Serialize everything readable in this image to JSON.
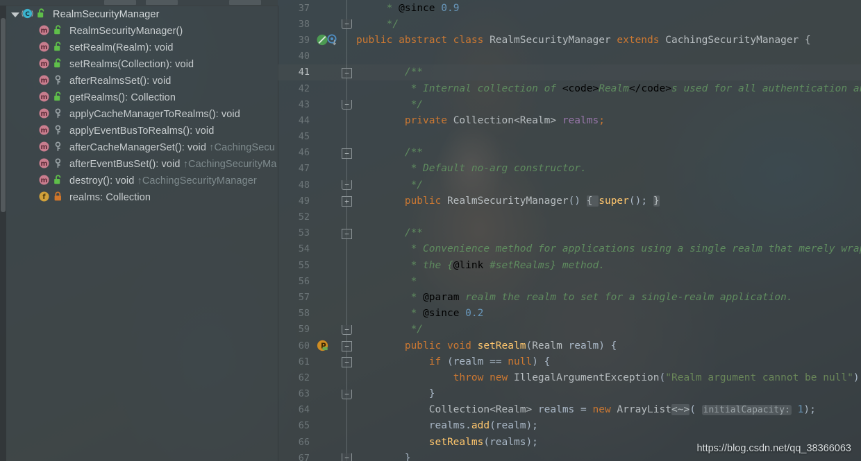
{
  "window": {
    "title": "RealmSecurityManager"
  },
  "toolbar": {
    "chips": [
      "",
      "",
      ""
    ]
  },
  "sidebar": {
    "root": {
      "label": "RealmSecurityManager",
      "icon": "class-icon",
      "visibility": "public-unlock-icon",
      "expanded": true,
      "caret": "chevron-down-icon"
    },
    "items": [
      {
        "label": "RealmSecurityManager()",
        "inherited": "",
        "icon": "method-icon",
        "visibility": "public-unlock-icon"
      },
      {
        "label": "setRealm(Realm): void",
        "inherited": "",
        "icon": "method-icon",
        "visibility": "public-unlock-icon"
      },
      {
        "label": "setRealms(Collection<Realm>): void",
        "inherited": "",
        "icon": "method-icon",
        "visibility": "public-unlock-icon"
      },
      {
        "label": "afterRealmsSet(): void",
        "inherited": "",
        "icon": "method-icon",
        "visibility": "protected-key-icon"
      },
      {
        "label": "getRealms(): Collection<Realm>",
        "inherited": "",
        "icon": "method-icon",
        "visibility": "public-unlock-icon"
      },
      {
        "label": "applyCacheManagerToRealms(): void",
        "inherited": "",
        "icon": "method-icon",
        "visibility": "protected-key-icon"
      },
      {
        "label": "applyEventBusToRealms(): void",
        "inherited": "",
        "icon": "method-icon",
        "visibility": "protected-key-icon"
      },
      {
        "label": "afterCacheManagerSet(): void",
        "inherited": "↑CachingSecu",
        "icon": "method-icon",
        "visibility": "protected-key-icon"
      },
      {
        "label": "afterEventBusSet(): void",
        "inherited": "↑CachingSecurityMa",
        "icon": "method-icon",
        "visibility": "protected-key-icon"
      },
      {
        "label": "destroy(): void",
        "inherited": "↑CachingSecurityManager",
        "icon": "method-icon",
        "visibility": "public-unlock-icon"
      },
      {
        "label": "realms: Collection<Realm>",
        "inherited": "",
        "icon": "field-icon",
        "visibility": "private-lock-icon"
      }
    ]
  },
  "editor": {
    "highlighted_line": 41,
    "lines": [
      {
        "num": "37",
        "mark": "",
        "fold": "",
        "indent": 1,
        "tokens": [
          {
            "t": "cmt",
            "v": " * "
          },
          {
            "t": "tag",
            "v": "@since"
          },
          {
            "t": "cmt",
            "v": " "
          },
          {
            "t": "num",
            "v": "0.9"
          }
        ]
      },
      {
        "num": "38",
        "mark": "",
        "fold": "end",
        "indent": 1,
        "tokens": [
          {
            "t": "cmt",
            "v": " */"
          }
        ]
      },
      {
        "num": "39",
        "mark": "implemented-gutter-icon",
        "fold": "",
        "indent": 0,
        "tokens": [
          {
            "t": "kw",
            "v": "public abstract class "
          },
          {
            "t": "cls",
            "v": "RealmSecurityManager "
          },
          {
            "t": "kw",
            "v": "extends "
          },
          {
            "t": "cls",
            "v": "CachingSecurityManager {"
          }
        ]
      },
      {
        "num": "40",
        "mark": "",
        "fold": "",
        "indent": 0,
        "tokens": []
      },
      {
        "num": "41",
        "mark": "",
        "fold": "start",
        "indent": 2,
        "tokens": [
          {
            "t": "cmt",
            "v": "/**"
          }
        ]
      },
      {
        "num": "42",
        "mark": "",
        "fold": "",
        "indent": 2,
        "tokens": [
          {
            "t": "cmt",
            "v": " * Internal collection of "
          },
          {
            "t": "html",
            "v": "<code>"
          },
          {
            "t": "cmt",
            "v": "Realm"
          },
          {
            "t": "html",
            "v": "</code>"
          },
          {
            "t": "cmt",
            "v": "s used for all authentication and authorizati"
          }
        ]
      },
      {
        "num": "43",
        "mark": "",
        "fold": "end",
        "indent": 2,
        "tokens": [
          {
            "t": "cmt",
            "v": " */"
          }
        ]
      },
      {
        "num": "44",
        "mark": "",
        "fold": "",
        "indent": 2,
        "tokens": [
          {
            "t": "kw",
            "v": "private "
          },
          {
            "t": "cls",
            "v": "Collection<Realm> "
          },
          {
            "t": "fld",
            "v": "realms"
          },
          {
            "t": "kw",
            "v": ";"
          }
        ]
      },
      {
        "num": "45",
        "mark": "",
        "fold": "",
        "indent": 0,
        "tokens": []
      },
      {
        "num": "46",
        "mark": "",
        "fold": "start",
        "indent": 2,
        "tokens": [
          {
            "t": "cmt",
            "v": "/**"
          }
        ]
      },
      {
        "num": "47",
        "mark": "",
        "fold": "",
        "indent": 2,
        "tokens": [
          {
            "t": "cmt",
            "v": " * Default no-arg constructor."
          }
        ]
      },
      {
        "num": "48",
        "mark": "",
        "fold": "end",
        "indent": 2,
        "tokens": [
          {
            "t": "cmt",
            "v": " */"
          }
        ]
      },
      {
        "num": "49",
        "mark": "",
        "fold": "collapsed",
        "indent": 2,
        "tokens": [
          {
            "t": "kw",
            "v": "public "
          },
          {
            "t": "cls",
            "v": "RealmSecurityManager"
          },
          {
            "t": "txt",
            "v": "() "
          },
          {
            "t": "foldph",
            "v": "{ "
          },
          {
            "t": "mth",
            "v": "super"
          },
          {
            "t": "txt",
            "v": "(); "
          },
          {
            "t": "foldph",
            "v": "}"
          }
        ]
      },
      {
        "num": "52",
        "mark": "",
        "fold": "",
        "indent": 0,
        "tokens": []
      },
      {
        "num": "53",
        "mark": "",
        "fold": "start",
        "indent": 2,
        "tokens": [
          {
            "t": "cmt",
            "v": "/**"
          }
        ]
      },
      {
        "num": "54",
        "mark": "",
        "fold": "",
        "indent": 2,
        "tokens": [
          {
            "t": "cmt",
            "v": " * Convenience method for applications using a single realm that merely wraps the realm i"
          }
        ]
      },
      {
        "num": "55",
        "mark": "",
        "fold": "",
        "indent": 2,
        "tokens": [
          {
            "t": "cmt",
            "v": " * the {"
          },
          {
            "t": "tag",
            "v": "@link"
          },
          {
            "t": "cmt",
            "v": " #setRealms} method."
          }
        ]
      },
      {
        "num": "56",
        "mark": "",
        "fold": "",
        "indent": 2,
        "tokens": [
          {
            "t": "cmt",
            "v": " *"
          }
        ]
      },
      {
        "num": "57",
        "mark": "",
        "fold": "",
        "indent": 2,
        "tokens": [
          {
            "t": "cmt",
            "v": " * "
          },
          {
            "t": "tag",
            "v": "@param"
          },
          {
            "t": "cmt",
            "v": " realm the realm to set for a single-realm application."
          }
        ]
      },
      {
        "num": "58",
        "mark": "",
        "fold": "",
        "indent": 2,
        "tokens": [
          {
            "t": "cmt",
            "v": " * "
          },
          {
            "t": "tag",
            "v": "@since"
          },
          {
            "t": "cmt",
            "v": " "
          },
          {
            "t": "num",
            "v": "0.2"
          }
        ]
      },
      {
        "num": "59",
        "mark": "",
        "fold": "end",
        "indent": 2,
        "tokens": [
          {
            "t": "cmt",
            "v": " */"
          }
        ]
      },
      {
        "num": "60",
        "mark": "override-gutter-icon",
        "fold": "start",
        "indent": 2,
        "tokens": [
          {
            "t": "kw",
            "v": "public void "
          },
          {
            "t": "mth",
            "v": "setRealm"
          },
          {
            "t": "txt",
            "v": "("
          },
          {
            "t": "cls",
            "v": "Realm"
          },
          {
            "t": "txt",
            "v": " realm) {"
          }
        ]
      },
      {
        "num": "61",
        "mark": "",
        "fold": "start",
        "indent": 3,
        "tokens": [
          {
            "t": "kw",
            "v": "if "
          },
          {
            "t": "txt",
            "v": "(realm == "
          },
          {
            "t": "kw",
            "v": "null"
          },
          {
            "t": "txt",
            "v": ") {"
          }
        ]
      },
      {
        "num": "62",
        "mark": "",
        "fold": "",
        "indent": 4,
        "tokens": [
          {
            "t": "kw",
            "v": "throw new "
          },
          {
            "t": "cls",
            "v": "IllegalArgumentException"
          },
          {
            "t": "txt",
            "v": "("
          },
          {
            "t": "str",
            "v": "\"Realm argument cannot be null\""
          },
          {
            "t": "txt",
            "v": ");"
          }
        ]
      },
      {
        "num": "63",
        "mark": "",
        "fold": "end",
        "indent": 3,
        "tokens": [
          {
            "t": "txt",
            "v": "}"
          }
        ]
      },
      {
        "num": "64",
        "mark": "",
        "fold": "",
        "indent": 3,
        "tokens": [
          {
            "t": "cls",
            "v": "Collection<Realm>"
          },
          {
            "t": "txt",
            "v": " realms = "
          },
          {
            "t": "kw",
            "v": "new "
          },
          {
            "t": "cls",
            "v": "ArrayList"
          },
          {
            "t": "foldph",
            "v": "<~>"
          },
          {
            "t": "txt",
            "v": "( "
          },
          {
            "t": "hint",
            "v": "initialCapacity:"
          },
          {
            "t": "txt",
            "v": " "
          },
          {
            "t": "num",
            "v": "1"
          },
          {
            "t": "txt",
            "v": ");"
          }
        ]
      },
      {
        "num": "65",
        "mark": "",
        "fold": "",
        "indent": 3,
        "tokens": [
          {
            "t": "txt",
            "v": "realms."
          },
          {
            "t": "mth",
            "v": "add"
          },
          {
            "t": "txt",
            "v": "(realm);"
          }
        ]
      },
      {
        "num": "66",
        "mark": "",
        "fold": "",
        "indent": 3,
        "tokens": [
          {
            "t": "mth",
            "v": "setRealms"
          },
          {
            "t": "txt",
            "v": "(realms);"
          }
        ]
      },
      {
        "num": "67",
        "mark": "",
        "fold": "end",
        "indent": 2,
        "tokens": [
          {
            "t": "txt",
            "v": "}"
          }
        ]
      }
    ]
  },
  "watermark": {
    "text": "https://blog.csdn.net/qq_38366063"
  },
  "colors": {
    "keyword": "#cc7832",
    "comment": "#5f8c5f",
    "string": "#6a8759",
    "number": "#6897bb",
    "field": "#9876aa",
    "method": "#ffc66d",
    "class_icon": "#3bb9d4",
    "method_icon": "#c97d8e",
    "field_icon": "#d2a13a"
  }
}
